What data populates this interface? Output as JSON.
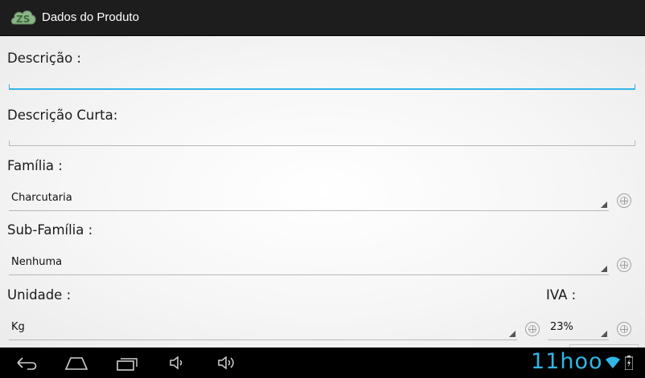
{
  "action_bar": {
    "logo_icon": "zs-cloud-logo-icon",
    "title": "Dados do Produto"
  },
  "form": {
    "descricao": {
      "label": "Descrição :",
      "value": ""
    },
    "descricao_curta": {
      "label": "Descrição Curta:",
      "value": ""
    },
    "familia": {
      "label": "Família :",
      "selected": "Charcutaria"
    },
    "sub_familia": {
      "label": "Sub-Família :",
      "selected": "Nenhuma"
    },
    "unidade": {
      "label": "Unidade :",
      "selected": "Kg"
    },
    "iva": {
      "label": "IVA :",
      "selected": "23%"
    }
  },
  "nav_bar": {
    "icons": [
      "back-icon",
      "home-icon",
      "recent-apps-icon",
      "volume-down-icon",
      "volume-up-icon"
    ],
    "brand_text": "11hoo",
    "status_icons": [
      "wifi-icon",
      "battery-icon"
    ]
  },
  "colors": {
    "accent": "#33b5e5",
    "action_bar": "#1d1d1d",
    "nav_bar": "#000000"
  }
}
